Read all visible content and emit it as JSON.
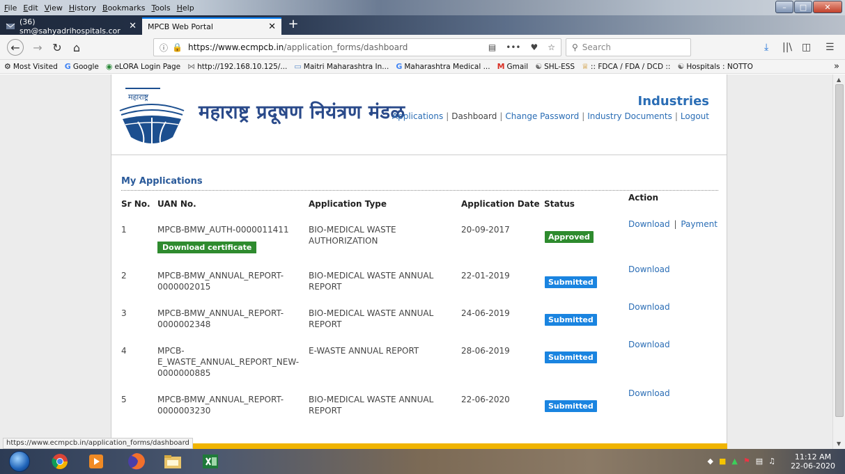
{
  "menu": [
    "File",
    "Edit",
    "View",
    "History",
    "Bookmarks",
    "Tools",
    "Help"
  ],
  "tabs": [
    {
      "label": "(36) sm@sahyadrihospitals.cor",
      "active": false
    },
    {
      "label": "MPCB Web Portal",
      "active": true
    }
  ],
  "nav": {
    "url_host": "https://www.ecmpcb.in",
    "url_path": "/application_forms/dashboard",
    "url_more": "•••",
    "search_placeholder": "Search"
  },
  "bookmarks": [
    {
      "label": "Most Visited",
      "icon": "gear-icon"
    },
    {
      "label": "Google",
      "icon": "google-icon"
    },
    {
      "label": "eLORA Login Page",
      "icon": "elora-icon"
    },
    {
      "label": "http://192.168.10.125/...",
      "icon": "network-icon"
    },
    {
      "label": "Maitri Maharashtra In...",
      "icon": "page-icon"
    },
    {
      "label": "Maharashtra Medical ...",
      "icon": "google-icon"
    },
    {
      "label": "Gmail",
      "icon": "gmail-icon"
    },
    {
      "label": "SHL-ESS",
      "icon": "globe-icon"
    },
    {
      "label": ":: FDCA / FDA / DCD ::",
      "icon": "emblem-icon"
    },
    {
      "label": "Hospitals : NOTTO",
      "icon": "globe-icon"
    }
  ],
  "site": {
    "logo_text": "महाराष्ट्र",
    "brand": "महाराष्ट्र प्रदूषण नियंत्रण मंडळ",
    "portal": "Industries",
    "nav_links": [
      {
        "label": "Applications",
        "current": false
      },
      {
        "label": "Dashboard",
        "current": true
      },
      {
        "label": "Change Password",
        "current": false
      },
      {
        "label": "Industry Documents",
        "current": false
      },
      {
        "label": "Logout",
        "current": false
      }
    ]
  },
  "applications": {
    "title": "My Applications",
    "headers": {
      "sr": "Sr No.",
      "uan": "UAN No.",
      "type": "Application Type",
      "date": "Application Date",
      "status": "Status",
      "action": "Action"
    },
    "rows": [
      {
        "sr": "1",
        "uan": [
          "MPCB-BMW_AUTH-0000011411"
        ],
        "type": [
          "BIO-MEDICAL WASTE",
          "AUTHORIZATION"
        ],
        "date": "20-09-2017",
        "status": "Approved",
        "actions": [
          "Download",
          "Payment"
        ],
        "extra_button": "Download certificate"
      },
      {
        "sr": "2",
        "uan": [
          "MPCB-BMW_ANNUAL_REPORT-",
          "0000002015"
        ],
        "type": [
          "BIO-MEDICAL WASTE ANNUAL",
          "REPORT"
        ],
        "date": "22-01-2019",
        "status": "Submitted",
        "actions": [
          "Download"
        ]
      },
      {
        "sr": "3",
        "uan": [
          "MPCB-BMW_ANNUAL_REPORT-",
          "0000002348"
        ],
        "type": [
          "BIO-MEDICAL WASTE ANNUAL",
          "REPORT"
        ],
        "date": "24-06-2019",
        "status": "Submitted",
        "actions": [
          "Download"
        ]
      },
      {
        "sr": "4",
        "uan": [
          "MPCB-",
          "E_WASTE_ANNUAL_REPORT_NEW-",
          "0000000885"
        ],
        "type": [
          "E-WASTE ANNUAL REPORT"
        ],
        "date": "28-06-2019",
        "status": "Submitted",
        "actions": [
          "Download"
        ]
      },
      {
        "sr": "5",
        "uan": [
          "MPCB-BMW_ANNUAL_REPORT-",
          "0000003230"
        ],
        "type": [
          "BIO-MEDICAL WASTE ANNUAL",
          "REPORT"
        ],
        "date": "22-06-2020",
        "status": "Submitted",
        "actions": [
          "Download"
        ]
      }
    ]
  },
  "status_tooltip": "https://www.ecmpcb.in/application_forms/dashboard",
  "taskbar": {
    "time": "11:12 AM",
    "date": "22-06-2020"
  },
  "colors": {
    "link": "#2a6db5",
    "approved": "#2e8b2e",
    "submitted": "#1a84e0",
    "footer_strip": "#f0b400"
  }
}
